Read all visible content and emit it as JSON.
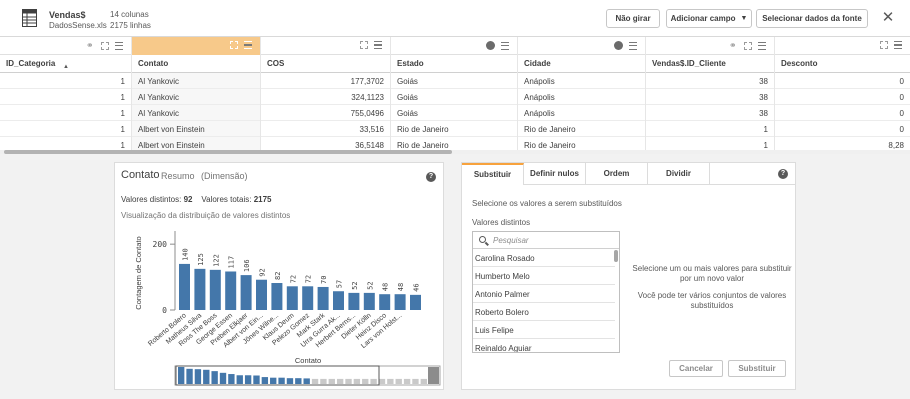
{
  "header": {
    "table_name": "Vendas$",
    "file_name": "DadosSense.xls",
    "columns_count": "14 colunas",
    "rows_count": "2175 linhas",
    "btn_nao_girar": "Não girar",
    "btn_adicionar_campo": "Adicionar campo",
    "btn_selecionar": "Selecionar dados da fonte",
    "close_glyph": "✕"
  },
  "table": {
    "columns": [
      {
        "label": "ID_Categoria",
        "sort_glyph": "▲",
        "cells": [
          "1",
          "1",
          "1",
          "1",
          "1"
        ]
      },
      {
        "label": "Contato",
        "cells": [
          "Al Yankovic",
          "Al Yankovic",
          "Al Yankovic",
          "Albert von Einstein",
          "Albert von Einstein"
        ]
      },
      {
        "label": "COS",
        "cells": [
          "177,3702",
          "324,1123",
          "755,0496",
          "33,516",
          "36,5148"
        ]
      },
      {
        "label": "Estado",
        "cells": [
          "Goiás",
          "Goiás",
          "Goiás",
          "Rio de Janeiro",
          "Rio de Janeiro"
        ]
      },
      {
        "label": "Cidade",
        "cells": [
          "Anápolis",
          "Anápolis",
          "Anápolis",
          "Rio de Janeiro",
          "Rio de Janeiro"
        ]
      },
      {
        "label": "Vendas$.ID_Cliente",
        "cells": [
          "38",
          "38",
          "38",
          "1",
          "1"
        ]
      },
      {
        "label": "Desconto",
        "cells": [
          "0",
          "0",
          "0",
          "0",
          "8,28"
        ]
      }
    ],
    "accent_color": "#f7c98a",
    "icon_names": [
      "link-icon",
      "expand-icon",
      "menu-icon",
      "globe-icon"
    ]
  },
  "left_panel": {
    "title": "Contato",
    "tab_resumo": "Resumo",
    "tab_dimensao": "(Dimensão)",
    "distinct_label": "Valores distintos:",
    "distinct_value": "92",
    "total_label": "Valores totais:",
    "total_value": "2175",
    "vis_label": "Visualização da distribuição de valores distintos",
    "help_glyph": "?"
  },
  "chart_data": {
    "type": "bar",
    "categories": [
      "Roberto Bolero",
      "Matheus Silva",
      "Ross The Boss",
      "George Essen",
      "Preben Elkjaer",
      "Albert von Ein...",
      "Jônes Wilne...",
      "Klaus Deum",
      "Pelezo Gomez",
      "Mark Stark",
      "Urra Gurra Ak...",
      "Herbert Berns...",
      "Dieter Kölln",
      "Heinz Disco",
      "Lars von Holst...",
      ""
    ],
    "values": [
      140,
      125,
      122,
      117,
      106,
      92,
      82,
      72,
      72,
      70,
      57,
      52,
      52,
      48,
      48,
      46
    ],
    "data_labels": [
      "140",
      "125",
      "122",
      "117",
      "106",
      "92",
      "82",
      "72",
      "72",
      "70",
      "57",
      "52",
      "52",
      "48",
      "48",
      "46"
    ],
    "ylabel": "Contagem de Contato",
    "xlabel": "Contato",
    "y_ticks": [
      "0",
      "200"
    ],
    "ylim": [
      0,
      240
    ],
    "bar_color": "#4477aa"
  },
  "right_panel": {
    "tabs": [
      "Substituir",
      "Definir nulos",
      "Ordem",
      "Dividir"
    ],
    "instruction": "Selecione os valores a serem substituídos",
    "list_label": "Valores distintos",
    "search_placeholder": "Pesquisar",
    "values": [
      "Carolina Rosado",
      "Humberto Melo",
      "Antonio Palmer",
      "Roberto Bolero",
      "Luis Felipe",
      "Reinaldo Aguiar"
    ],
    "info_line1": "Selecione um ou mais valores para substituir por um novo valor",
    "info_line2": "Você pode ter vários conjuntos de valores substituídos",
    "btn_cancelar": "Cancelar",
    "btn_substituir": "Substituir",
    "accent_color": "#f7a23d",
    "help_glyph": "?"
  }
}
